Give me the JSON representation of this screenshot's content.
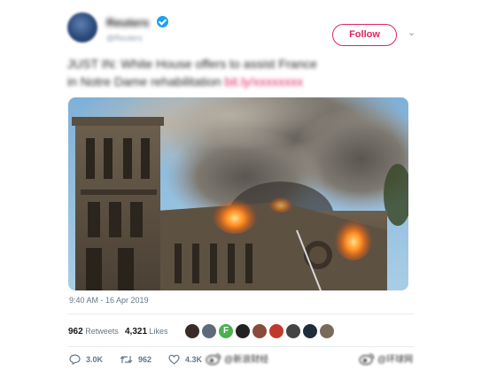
{
  "tweet": {
    "display_name": "Reuters",
    "handle": "@Reuters",
    "verified": true,
    "text_line1": "JUST IN: White House offers to assist France",
    "text_line2": "in Notre Dame rehabilitation",
    "link_text": "bit.ly/xxxxxxxx",
    "follow_label": "Follow",
    "timestamp": "9:40 AM - 16 Apr 2019",
    "retweets_count": "962",
    "retweets_label": "Retweets",
    "likes_count": "4,321",
    "likes_label": "Likes",
    "actions": {
      "replies": "3.0K",
      "retweets": "962",
      "likes": "4.3K"
    },
    "likers": [
      {
        "icon": "avatar-1",
        "color": "#3a2a2a"
      },
      {
        "icon": "avatar-2",
        "color": "#5e6b7a"
      },
      {
        "icon": "avatar-3-letter",
        "color": "#4caf50",
        "letter": "F"
      },
      {
        "icon": "avatar-4",
        "color": "#222222"
      },
      {
        "icon": "avatar-5",
        "color": "#8a4b3a"
      },
      {
        "icon": "avatar-6",
        "color": "#c0392b"
      },
      {
        "icon": "avatar-7",
        "color": "#444444"
      },
      {
        "icon": "avatar-8",
        "color": "#1f2c3a"
      },
      {
        "icon": "avatar-9",
        "color": "#7a6a5a"
      }
    ]
  },
  "watermarks": {
    "left": "@新浪财经",
    "right": "@环球网"
  },
  "colors": {
    "accent_pink": "#e0245e",
    "twitter_blue": "#1da1f2",
    "muted": "#657786"
  }
}
